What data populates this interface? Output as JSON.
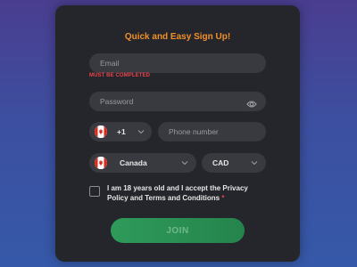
{
  "form": {
    "title": "Quick and Easy Sign Up!",
    "email": {
      "placeholder": "Email",
      "error": "MUST BE COMPLETED"
    },
    "password": {
      "placeholder": "Password"
    },
    "phone": {
      "code": "+1",
      "placeholder": "Phone number"
    },
    "country": {
      "value": "Canada"
    },
    "currency": {
      "value": "CAD"
    },
    "terms": {
      "text": "I am 18 years old and I accept the Privacy Policy and Terms and Conditions",
      "required_mark": "*"
    },
    "submit_label": "JOIN"
  },
  "colors": {
    "accent": "#f0902a",
    "error": "#e8434a",
    "button": "#2e9a5a",
    "card": "#25262b",
    "field": "#393a40"
  },
  "icons": [
    "eye-icon",
    "canada-flag-icon",
    "chevron-down-icon"
  ]
}
